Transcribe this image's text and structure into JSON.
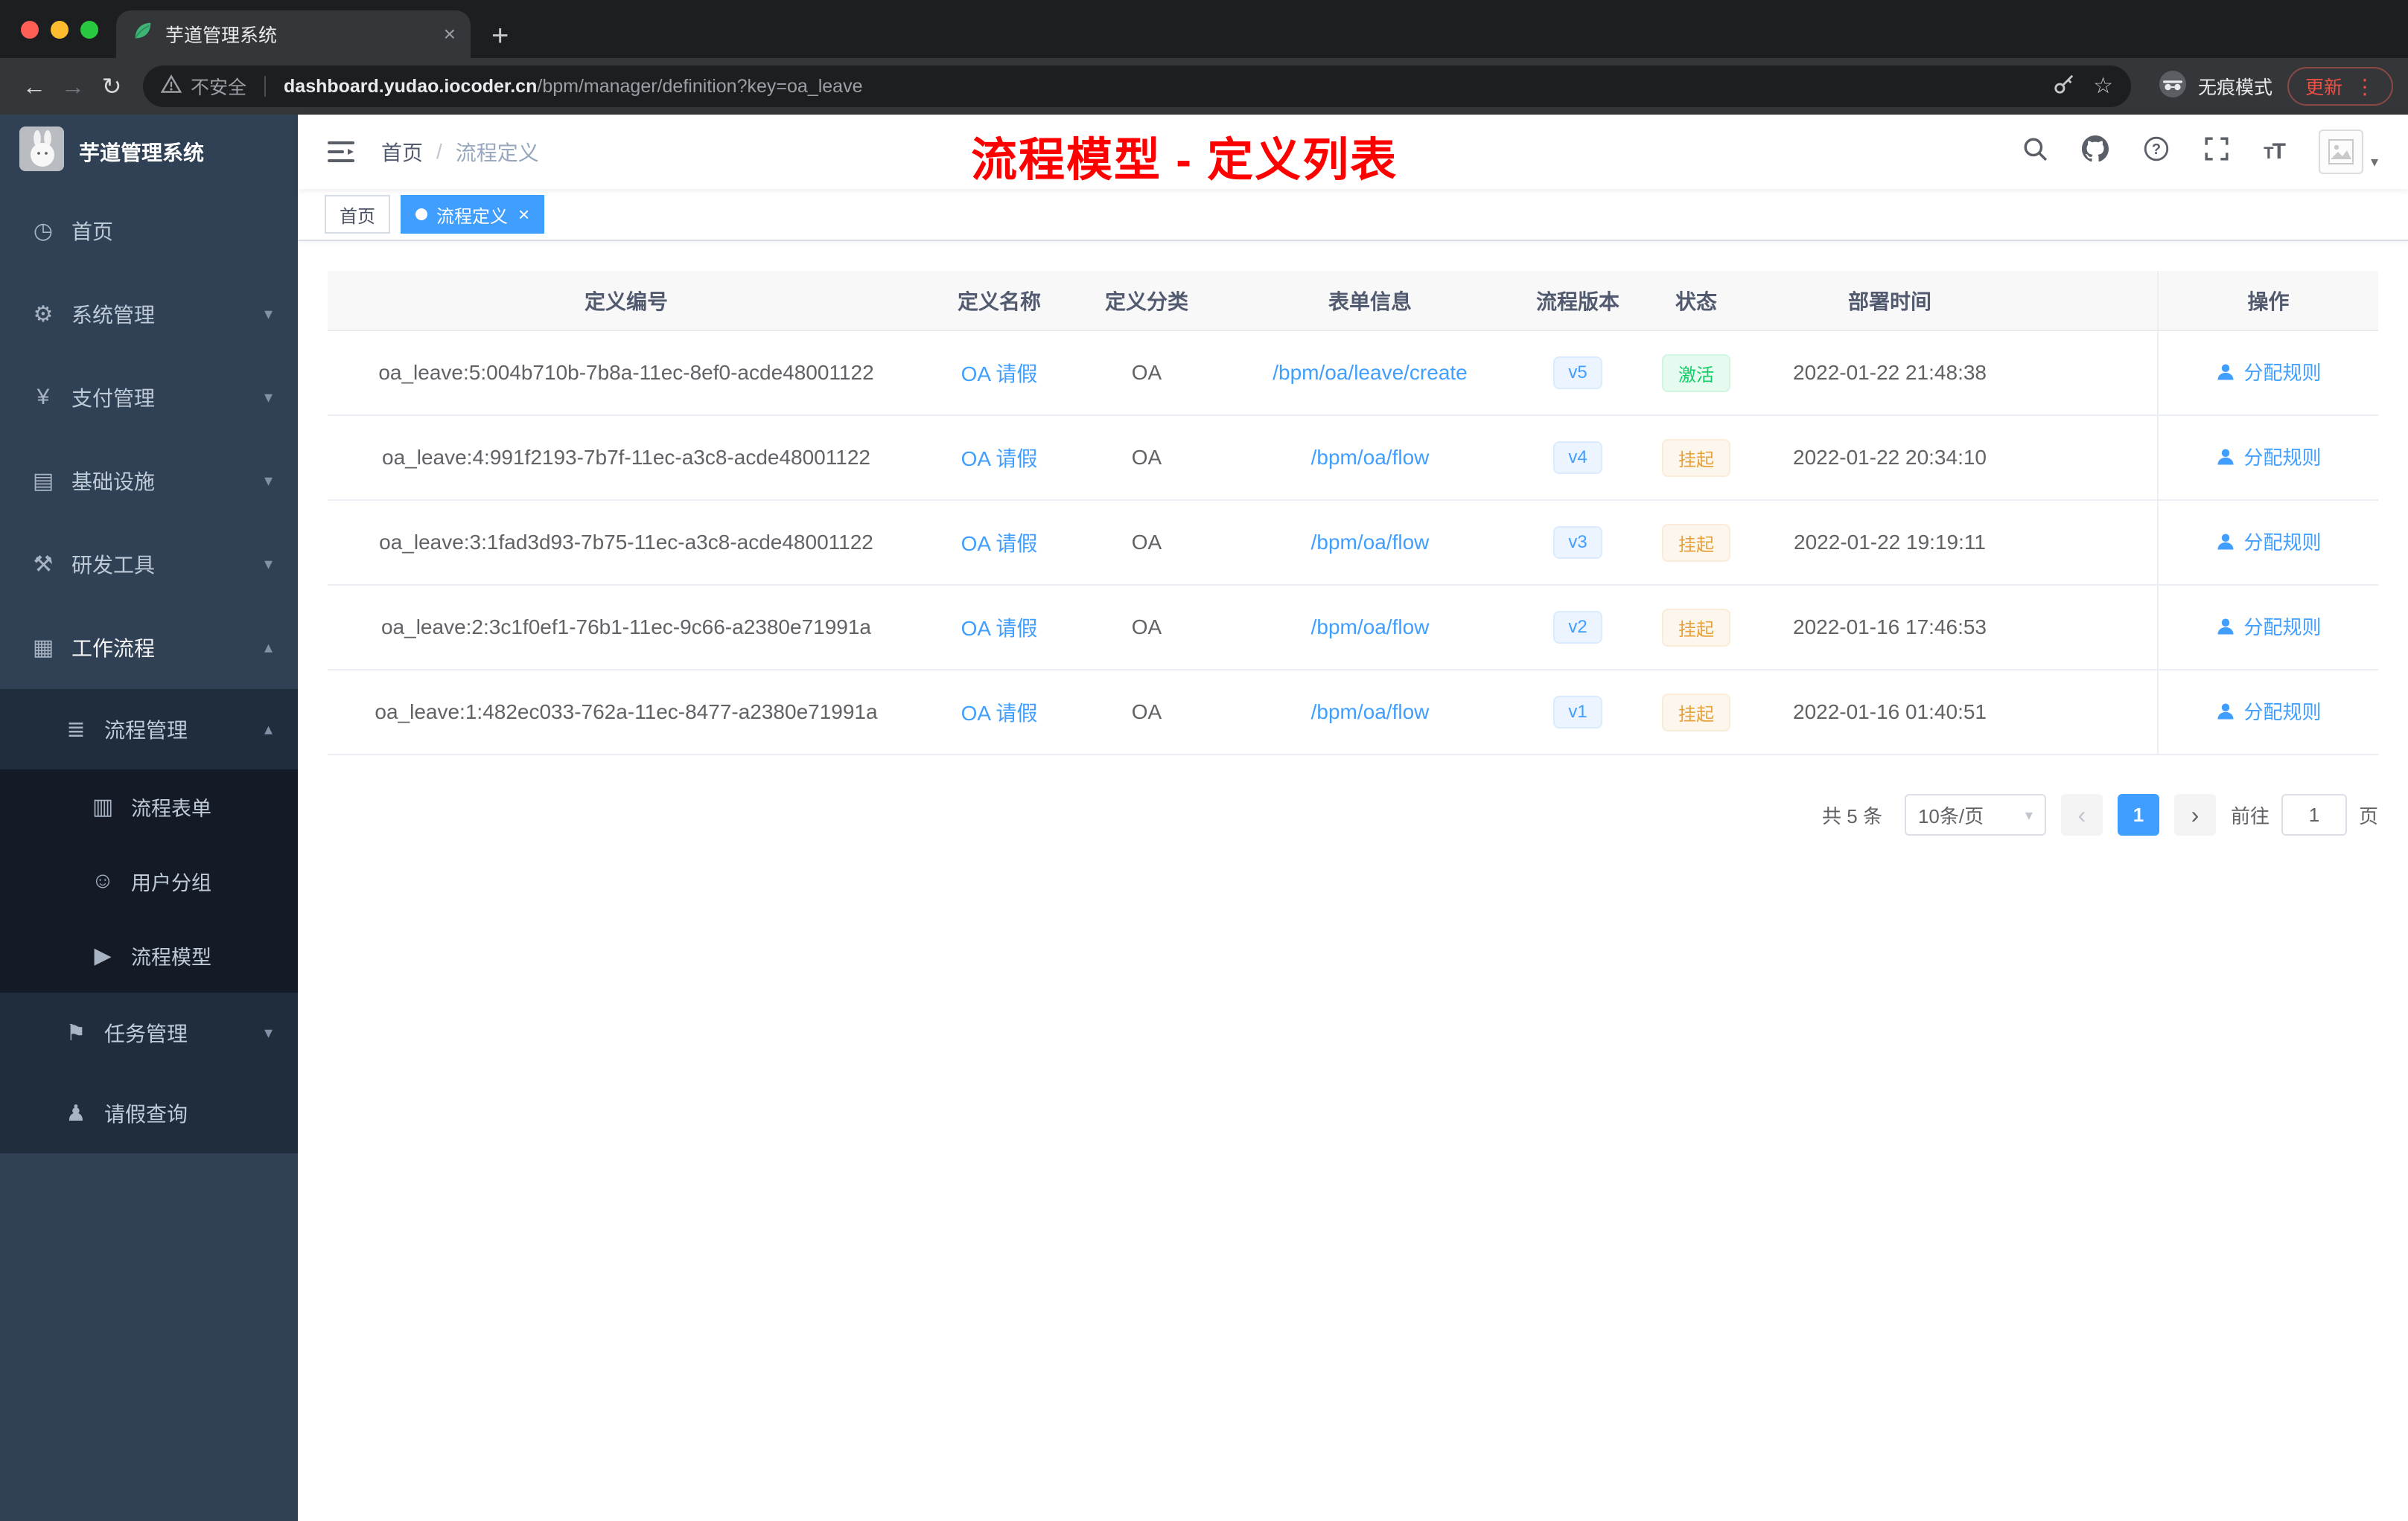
{
  "browser": {
    "tab_title": "芋道管理系统",
    "security_label": "不安全",
    "url_domain": "dashboard.yudao.iocoder.cn",
    "url_path": "/bpm/manager/definition?key=oa_leave",
    "incognito_label": "无痕模式",
    "update_label": "更新"
  },
  "sidebar": {
    "logo_title": "芋道管理系统",
    "items": [
      {
        "key": "home",
        "label": "首页",
        "icon": "dashboard-icon",
        "level": 0,
        "chevron": "",
        "active": false
      },
      {
        "key": "system",
        "label": "系统管理",
        "icon": "gear-icon",
        "level": 0,
        "chevron": "down",
        "active": false
      },
      {
        "key": "payment",
        "label": "支付管理",
        "icon": "yen-icon",
        "level": 0,
        "chevron": "down",
        "active": false
      },
      {
        "key": "infrastructure",
        "label": "基础设施",
        "icon": "monitor-icon",
        "level": 0,
        "chevron": "down",
        "active": false
      },
      {
        "key": "devtools",
        "label": "研发工具",
        "icon": "tools-icon",
        "level": 0,
        "chevron": "down",
        "active": false
      },
      {
        "key": "workflow",
        "label": "工作流程",
        "icon": "briefcase-icon",
        "level": 0,
        "chevron": "up",
        "active": true
      },
      {
        "key": "process-mgmt",
        "label": "流程管理",
        "icon": "list-icon",
        "level": 1,
        "chevron": "up",
        "active": false
      },
      {
        "key": "process-form",
        "label": "流程表单",
        "icon": "form-icon",
        "level": 2,
        "chevron": "",
        "active": false
      },
      {
        "key": "user-group",
        "label": "用户分组",
        "icon": "group-icon",
        "level": 2,
        "chevron": "",
        "active": false
      },
      {
        "key": "process-model",
        "label": "流程模型",
        "icon": "send-icon",
        "level": 2,
        "chevron": "",
        "active": false
      },
      {
        "key": "task-mgmt",
        "label": "任务管理",
        "icon": "flag-icon",
        "level": 1,
        "chevron": "down",
        "active": false
      },
      {
        "key": "leave-query",
        "label": "请假查询",
        "icon": "person-icon",
        "level": 1,
        "chevron": "",
        "active": false
      }
    ]
  },
  "header": {
    "breadcrumb": [
      "首页",
      "流程定义"
    ],
    "annotation": "流程模型 - 定义列表"
  },
  "tags": [
    {
      "label": "首页",
      "active": false
    },
    {
      "label": "流程定义",
      "active": true
    }
  ],
  "table": {
    "columns": [
      "定义编号",
      "定义名称",
      "定义分类",
      "表单信息",
      "流程版本",
      "状态",
      "部署时间",
      "操作"
    ],
    "rows": [
      {
        "id": "oa_leave:5:004b710b-7b8a-11ec-8ef0-acde48001122",
        "name": "OA 请假",
        "category": "OA",
        "form": "/bpm/oa/leave/create",
        "version": "v5",
        "status": "激活",
        "status_type": "success",
        "time": "2022-01-22 21:48:38",
        "action": "分配规则"
      },
      {
        "id": "oa_leave:4:991f2193-7b7f-11ec-a3c8-acde48001122",
        "name": "OA 请假",
        "category": "OA",
        "form": "/bpm/oa/flow",
        "version": "v4",
        "status": "挂起",
        "status_type": "warning",
        "time": "2022-01-22 20:34:10",
        "action": "分配规则"
      },
      {
        "id": "oa_leave:3:1fad3d93-7b75-11ec-a3c8-acde48001122",
        "name": "OA 请假",
        "category": "OA",
        "form": "/bpm/oa/flow",
        "version": "v3",
        "status": "挂起",
        "status_type": "warning",
        "time": "2022-01-22 19:19:11",
        "action": "分配规则"
      },
      {
        "id": "oa_leave:2:3c1f0ef1-76b1-11ec-9c66-a2380e71991a",
        "name": "OA 请假",
        "category": "OA",
        "form": "/bpm/oa/flow",
        "version": "v2",
        "status": "挂起",
        "status_type": "warning",
        "time": "2022-01-16 17:46:53",
        "action": "分配规则"
      },
      {
        "id": "oa_leave:1:482ec033-762a-11ec-8477-a2380e71991a",
        "name": "OA 请假",
        "category": "OA",
        "form": "/bpm/oa/flow",
        "version": "v1",
        "status": "挂起",
        "status_type": "warning",
        "time": "2022-01-16 01:40:51",
        "action": "分配规则"
      }
    ]
  },
  "pagination": {
    "total": "共 5 条",
    "page_size": "10条/页",
    "current_page": "1",
    "goto_label": "前往",
    "goto_value": "1",
    "page_unit": "页"
  },
  "colors": {
    "accent": "#409eff",
    "success": "#13ce66",
    "warning": "#e6a23c",
    "annotation": "#ff0000"
  }
}
